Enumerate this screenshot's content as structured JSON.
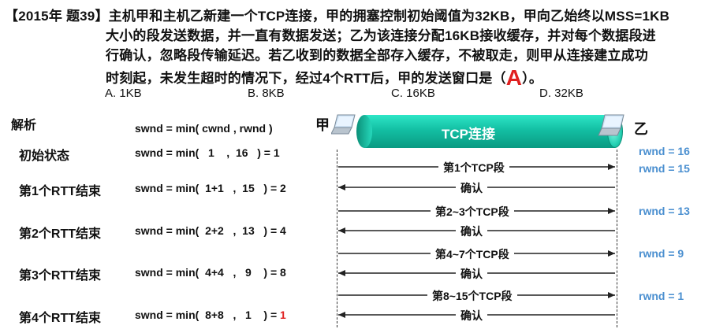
{
  "question": {
    "line1_prefix": "【2015年 题39】",
    "line1": "主机甲和主机乙新建一个TCP连接，甲的拥塞控制初始阈值为32KB，甲向乙始终以MSS=1KB",
    "line2": "大小的段发送数据，并一直有数据发送；乙为该连接分配16KB接收缓存，并对每个数据段进",
    "line3": "行确认，忽略段传输延迟。若乙收到的数据全部存入缓存，不被取走，则甲从连接建立成功",
    "line4_before": "时刻起，未发生超时的情况下，经过4个RTT后，甲的发送窗口是（",
    "answer": "A",
    "line4_after": "）。"
  },
  "options": [
    "A. 1KB",
    "B. 8KB",
    "C. 16KB",
    "D. 32KB"
  ],
  "analysis": {
    "heading": "解析",
    "header_formula": "swnd = min( cwnd , rwnd )",
    "rows": [
      {
        "label": "初始状态",
        "formula": "swnd = min(   1    ,  16   ) = 1",
        "result_red": ""
      },
      {
        "label": "第1个RTT结束",
        "formula": "swnd = min(  1+1   ,  15   ) = 2",
        "result_red": ""
      },
      {
        "label": "第2个RTT结束",
        "formula": "swnd = min(  2+2   ,  13   ) = 4",
        "result_red": ""
      },
      {
        "label": "第3个RTT结束",
        "formula": "swnd = min(  4+4   ,   9    ) = 8",
        "result_red": ""
      },
      {
        "label": "第4个RTT结束",
        "formula": "swnd = min(  8+8   ,   1    ) = ",
        "result_red": "1"
      }
    ]
  },
  "diagram": {
    "host_a": "甲",
    "host_b": "乙",
    "connection": "TCP连接",
    "messages": [
      {
        "text": "第1个TCP段",
        "direction": "right"
      },
      {
        "text": "确认",
        "direction": "left"
      },
      {
        "text": "第2~3个TCP段",
        "direction": "right"
      },
      {
        "text": "确认",
        "direction": "left"
      },
      {
        "text": "第4~7个TCP段",
        "direction": "right"
      },
      {
        "text": "确认",
        "direction": "left"
      },
      {
        "text": "第8~15个TCP段",
        "direction": "right"
      },
      {
        "text": "确认",
        "direction": "left"
      }
    ],
    "rwnd": [
      "rwnd = 16",
      "rwnd = 15",
      "rwnd = 13",
      "rwnd = 9",
      "rwnd = 1"
    ]
  },
  "colors": {
    "answer": "#e02020",
    "rwnd": "#4a8fd0",
    "pipe": "#13bfa3"
  },
  "icons": {
    "host_a": "laptop-icon",
    "host_b": "laptop-icon"
  }
}
